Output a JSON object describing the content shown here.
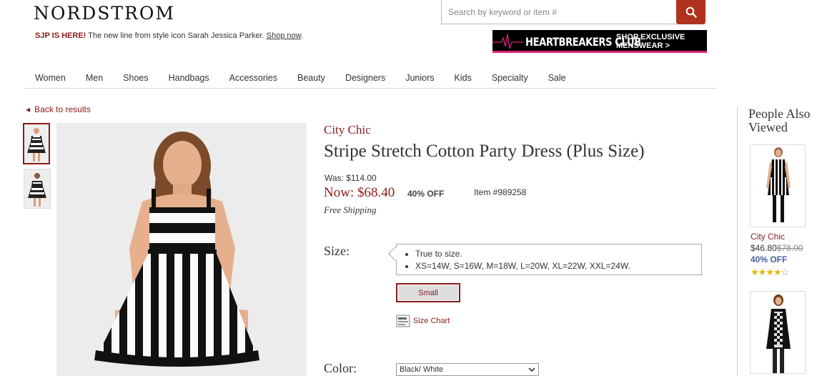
{
  "header": {
    "logo": "NORDSTROM",
    "promo": {
      "bold": "SJP IS HERE!",
      "text": " The new line from style icon Sarah Jessica Parker. ",
      "link": "Shop now",
      "end": "."
    },
    "search_placeholder": "Search by keyword or item #",
    "banner": {
      "title": "HEARTBREAKERS CLUB",
      "line1": "SHOP EXCLUSIVE",
      "line2": "MENSWEAR >"
    }
  },
  "nav": [
    "Women",
    "Men",
    "Shoes",
    "Handbags",
    "Accessories",
    "Beauty",
    "Designers",
    "Juniors",
    "Kids",
    "Specialty",
    "Sale"
  ],
  "back_link": "Back to results",
  "product": {
    "brand": "City Chic",
    "title": "Stripe Stretch Cotton Party Dress (Plus Size)",
    "was_price": "Was: $114.00",
    "now_price": "Now: $68.40",
    "discount": "40% OFF",
    "item_number": "Item #989258",
    "shipping": "Free Shipping",
    "size_label": "Size:",
    "size_tips": [
      "True to size.",
      "XS=14W, S=16W, M=18W, L=20W, XL=22W, XXL=24W."
    ],
    "size_option": "Small",
    "size_chart": "Size Chart",
    "color_label": "Color:",
    "color_value": "Black/ White"
  },
  "sidebar": {
    "title": "People Also Viewed",
    "items": [
      {
        "brand": "City Chic",
        "price": "$46.80",
        "orig_price": "$78.00",
        "discount": "40% OFF",
        "rating": 4,
        "rating_max": 5
      }
    ]
  },
  "colors": {
    "accent": "#8b1a1a",
    "search_button": "#b0311d",
    "discount_blue": "#4a5ea0",
    "star": "#e6b800"
  }
}
